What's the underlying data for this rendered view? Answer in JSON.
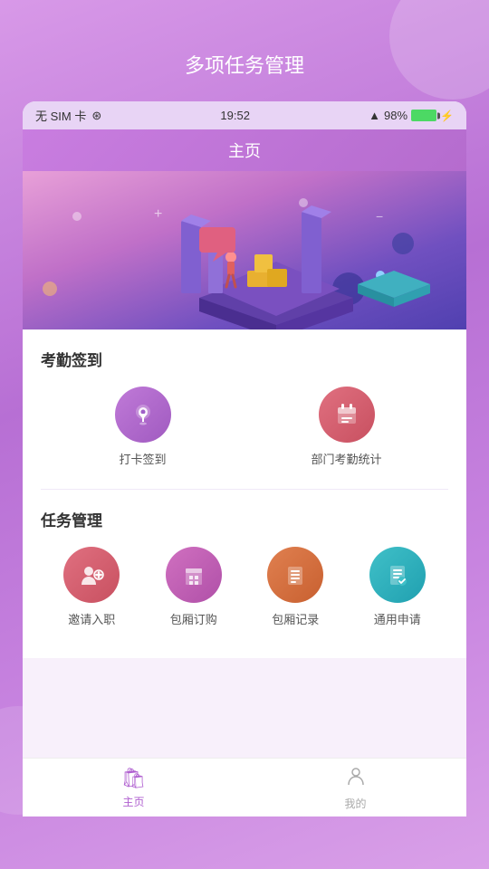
{
  "app": {
    "title": "多项任务管理"
  },
  "status_bar": {
    "left": "无 SIM 卡",
    "wifi": "📶",
    "time": "19:52",
    "arrow": "▲",
    "battery_pct": "98%"
  },
  "nav": {
    "title": "主页"
  },
  "sections": [
    {
      "id": "attendance",
      "title": "考勤签到",
      "items": [
        {
          "id": "checkin",
          "label": "打卡签到",
          "icon": "📍",
          "color_class": "purple-grad"
        },
        {
          "id": "dept_stats",
          "label": "部门考勤统计",
          "icon": "📋",
          "color_class": "red-grad"
        }
      ]
    },
    {
      "id": "task_mgmt",
      "title": "任务管理",
      "items": [
        {
          "id": "invite",
          "label": "邀请入职",
          "icon": "👤",
          "color_class": "red-grad"
        },
        {
          "id": "room_order",
          "label": "包厢订购",
          "icon": "🏢",
          "color_class": "pink-grad"
        },
        {
          "id": "room_record",
          "label": "包厢记录",
          "icon": "📃",
          "color_class": "orange-grad"
        },
        {
          "id": "apply",
          "label": "通用申请",
          "icon": "📝",
          "color_class": "teal-grad"
        }
      ]
    }
  ],
  "tabs": [
    {
      "id": "home",
      "label": "主页",
      "icon": "🛍",
      "active": true
    },
    {
      "id": "profile",
      "label": "我的",
      "icon": "👤",
      "active": false
    }
  ]
}
